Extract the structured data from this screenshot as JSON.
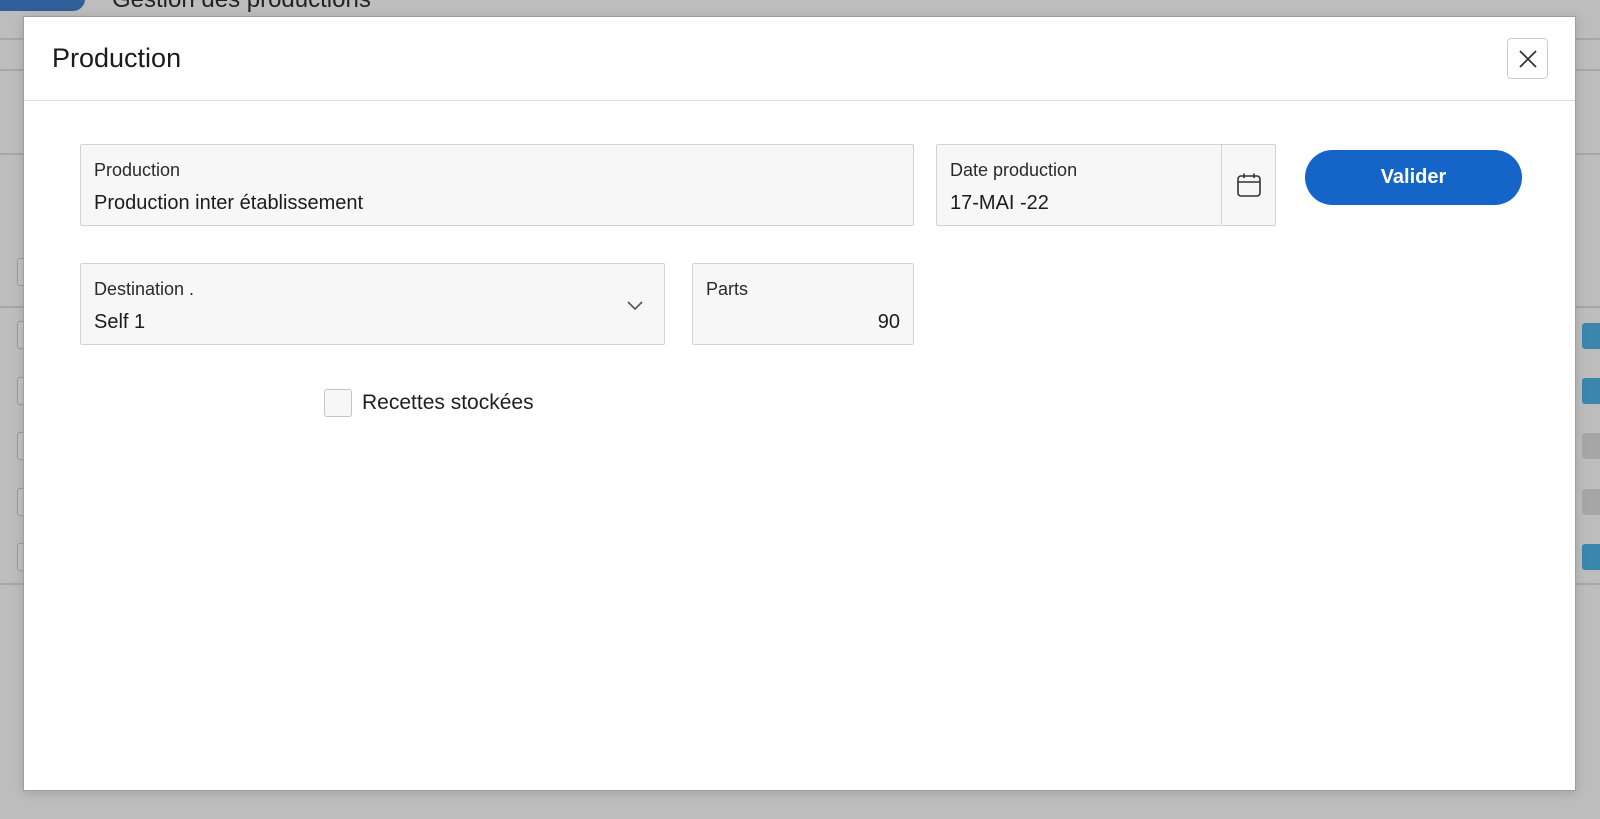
{
  "background": {
    "page_title": "Gestion des productions"
  },
  "modal": {
    "title": "Production",
    "fields": {
      "production": {
        "label": "Production",
        "value": "Production inter établissement"
      },
      "date": {
        "label": "Date production",
        "value": "17-MAI  -22",
        "icon": "calendar-icon"
      },
      "destination": {
        "label": "Destination .",
        "value": "Self 1",
        "icon": "chevron-down-icon"
      },
      "parts": {
        "label": "Parts",
        "value": "90"
      }
    },
    "valider_label": "Valider",
    "checkbox": {
      "label": "Recettes stockées",
      "checked": false
    }
  },
  "colors": {
    "primary": "#1565c8",
    "overlay": "#bdbdbd",
    "field_bg": "#f7f7f7"
  }
}
